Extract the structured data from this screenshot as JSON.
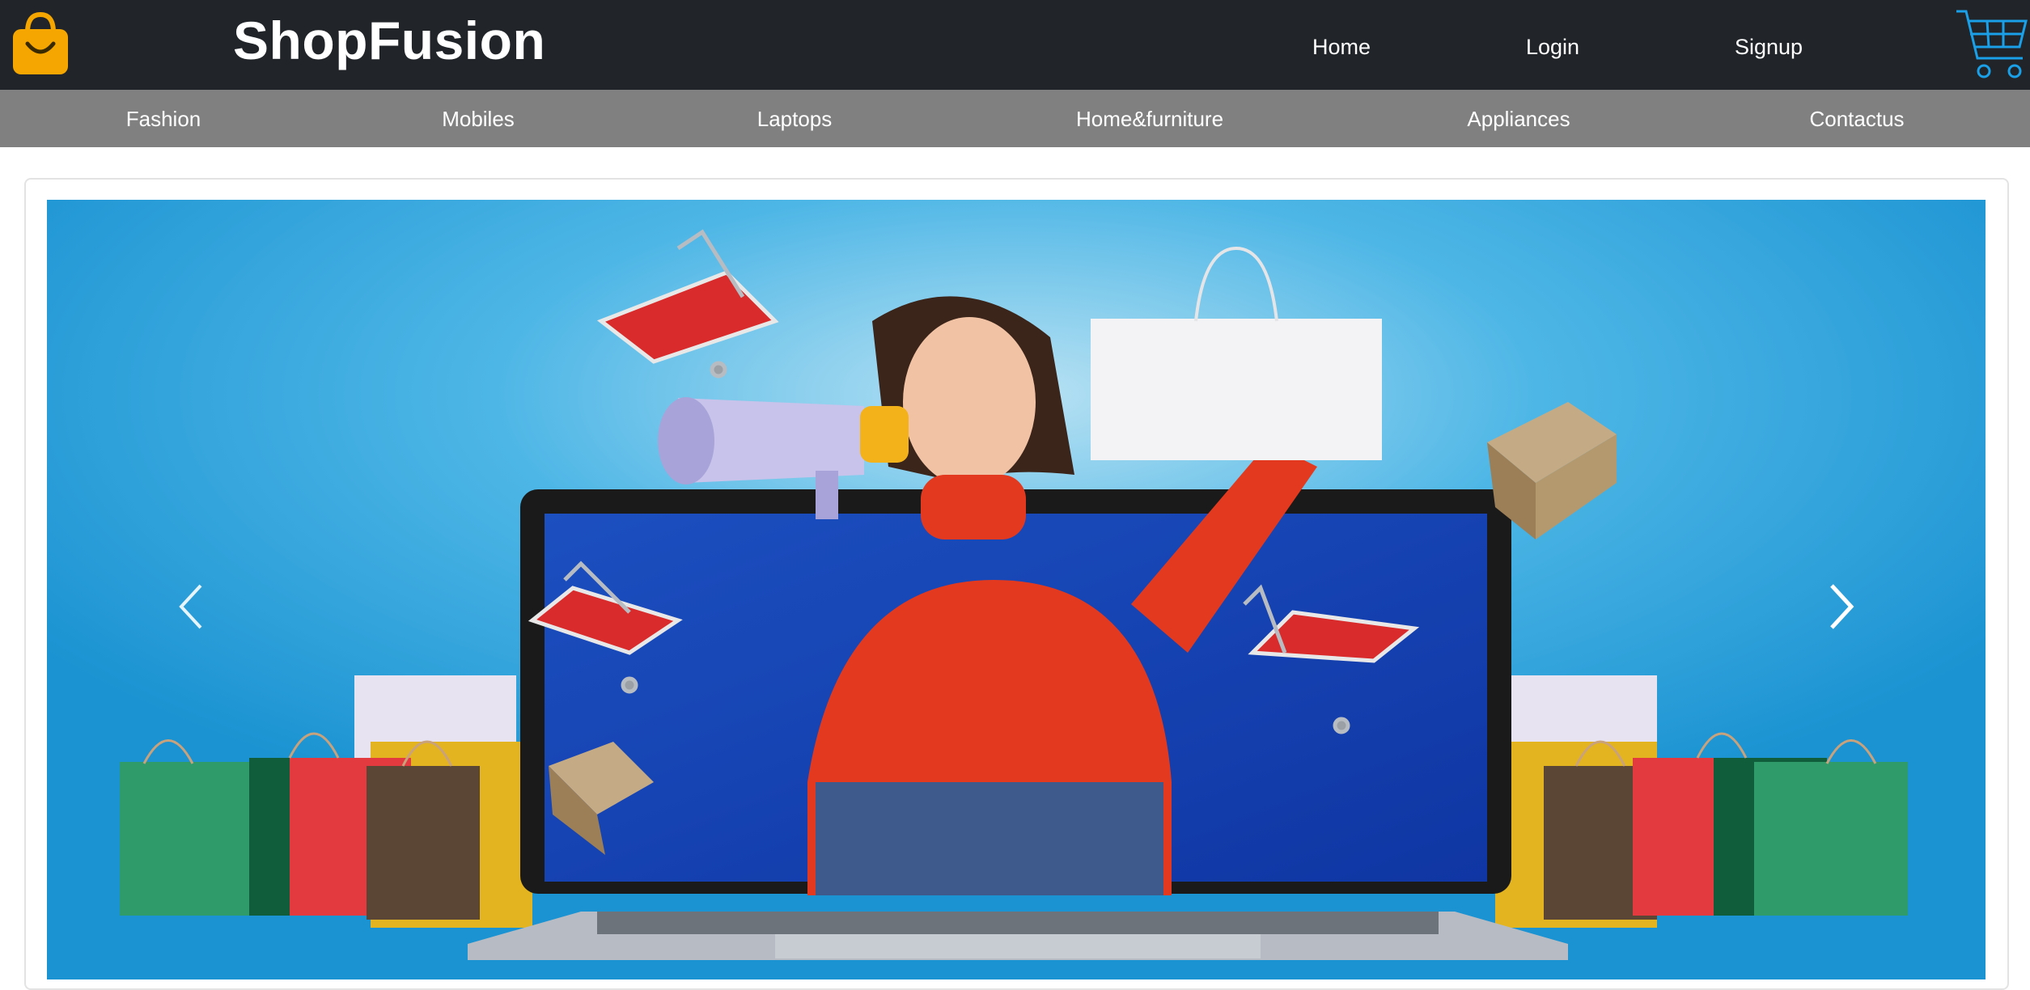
{
  "header": {
    "brand": "ShopFusion",
    "nav": [
      {
        "label": "Home"
      },
      {
        "label": "Login"
      },
      {
        "label": "Signup"
      }
    ],
    "icons": {
      "logo": "shopping-bag-icon",
      "cart": "shopping-cart-icon"
    }
  },
  "categories": [
    {
      "label": "Fashion"
    },
    {
      "label": "Mobiles"
    },
    {
      "label": "Laptops"
    },
    {
      "label": "Home&furniture"
    },
    {
      "label": "Appliances"
    },
    {
      "label": "Contactus"
    }
  ],
  "carousel": {
    "prev_icon": "chevron-left-icon",
    "next_icon": "chevron-right-icon"
  },
  "colors": {
    "topbar": "#212529",
    "category_bar": "#808080",
    "hero_bg": "#1f9ad6",
    "bag_icon": "#f5a600",
    "cart_icon": "#1aa0e8"
  }
}
